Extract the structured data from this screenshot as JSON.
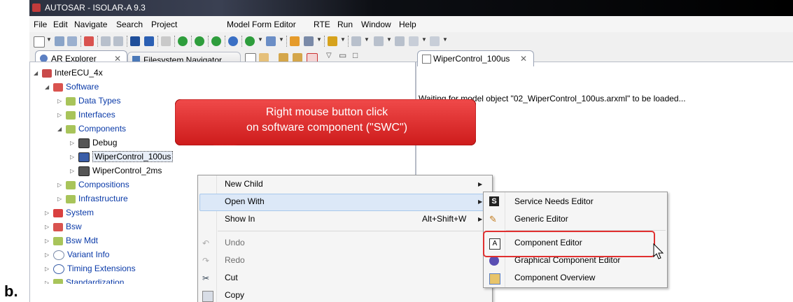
{
  "figure_label": "b.",
  "window": {
    "title": "AUTOSAR - ISOLAR-A 9.3"
  },
  "menubar": [
    "File",
    "Edit",
    "Navigate",
    "Search",
    "Project",
    "Model Form Editor",
    "RTE",
    "Run",
    "Window",
    "Help"
  ],
  "explorer": {
    "tabs": [
      "AR Explorer",
      "Filesystem Navigator"
    ],
    "tree": {
      "root": "InterECU_4x",
      "software": "Software",
      "data_types": "Data Types",
      "interfaces": "Interfaces",
      "components": "Components",
      "debug": "Debug",
      "wiper_100us": "WiperControl_100us",
      "wiper_2ms": "WiperControl_2ms",
      "compositions": "Compositions",
      "infrastructure": "Infrastructure",
      "system": "System",
      "bsw": "Bsw",
      "bsw_mdt": "Bsw Mdt",
      "variant_info": "Variant Info",
      "timing_extensions": "Timing Extensions",
      "standardization": "Standardization"
    }
  },
  "editor": {
    "tab": "WiperControl_100us",
    "message": "Waiting for model object \"02_WiperControl_100us.arxml\" to be loaded..."
  },
  "callout": {
    "line1": "Right mouse button click",
    "line2": "on software component (\"SWC\")"
  },
  "context_menu": {
    "new_child": "New Child",
    "open_with": "Open With",
    "show_in": "Show In",
    "show_in_shortcut": "Alt+Shift+W",
    "undo": "Undo",
    "redo": "Redo",
    "cut": "Cut",
    "copy": "Copy"
  },
  "submenu": {
    "service_needs": "Service Needs Editor",
    "generic": "Generic Editor",
    "component_editor": "Component Editor",
    "graphical": "Graphical Component Editor",
    "overview": "Component Overview"
  },
  "colors": {
    "callout": "#e01b1b",
    "highlight_border": "#e03030",
    "link_text": "#0a3aa8"
  }
}
